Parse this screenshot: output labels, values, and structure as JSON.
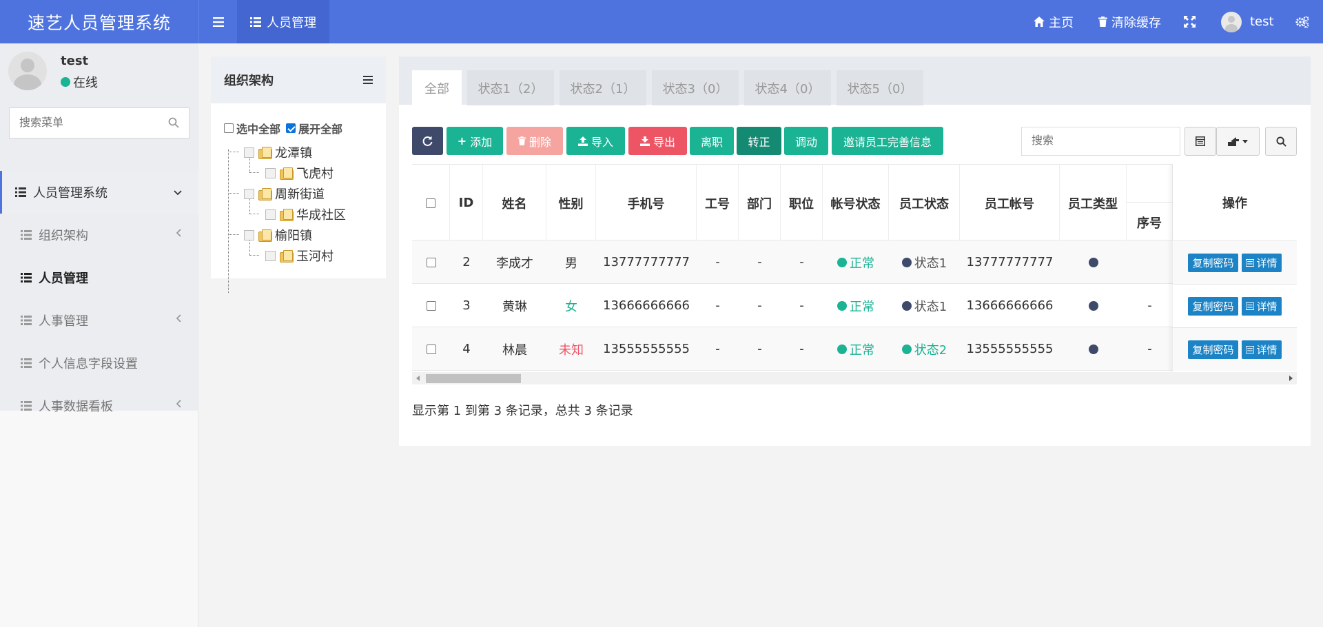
{
  "app": {
    "title": "速艺人员管理系统"
  },
  "topbar": {
    "nav_tab": "人员管理",
    "home": "主页",
    "clear_cache": "清除缓存",
    "username": "test",
    "brand_color": "#4e73df"
  },
  "sidebar": {
    "user": {
      "name": "test",
      "status": "在线"
    },
    "search_placeholder": "搜索菜单",
    "items": [
      {
        "label": "人员管理系统"
      },
      {
        "label": "组织架构"
      },
      {
        "label": "人员管理"
      },
      {
        "label": "人事管理"
      },
      {
        "label": "个人信息字段设置"
      },
      {
        "label": "人事数据看板"
      }
    ]
  },
  "org": {
    "title": "组织架构",
    "select_all": "选中全部",
    "expand_all": "展开全部",
    "expand_all_checked": true,
    "nodes": [
      {
        "label": "龙潭镇"
      },
      {
        "label": "飞虎村"
      },
      {
        "label": "周新街道"
      },
      {
        "label": "华成社区"
      },
      {
        "label": "榆阳镇"
      },
      {
        "label": "玉河村"
      }
    ]
  },
  "tabs": [
    "全部",
    "状态1（2）",
    "状态2（1）",
    "状态3（0）",
    "状态4（0）",
    "状态5（0）"
  ],
  "toolbar": {
    "add": "添加",
    "delete": "删除",
    "import": "导入",
    "export": "导出",
    "resign": "离职",
    "regularize": "转正",
    "transfer": "调动",
    "invite": "邀请员工完善信息",
    "search_placeholder": "搜索"
  },
  "table": {
    "headers": [
      "ID",
      "姓名",
      "性别",
      "手机号",
      "工号",
      "部门",
      "职位",
      "帐号状态",
      "员工状态",
      "员工帐号",
      "员工类型",
      "序号",
      "操作"
    ],
    "rows": [
      {
        "id": "2",
        "name": "李成才",
        "gender": "男",
        "phone": "13777777777",
        "job_no": "-",
        "dept": "-",
        "position": "-",
        "account_status": "正常",
        "emp_status": "状态1",
        "emp_account": "13777777777",
        "seq": ""
      },
      {
        "id": "3",
        "name": "黄琳",
        "gender": "女",
        "phone": "13666666666",
        "job_no": "-",
        "dept": "-",
        "position": "-",
        "account_status": "正常",
        "emp_status": "状态1",
        "emp_account": "13666666666",
        "seq": "-"
      },
      {
        "id": "4",
        "name": "林晨",
        "gender": "未知",
        "phone": "13555555555",
        "job_no": "-",
        "dept": "-",
        "position": "-",
        "account_status": "正常",
        "emp_status": "状态2",
        "emp_account": "13555555555",
        "seq": "-"
      }
    ],
    "copy_pwd": "复制密码",
    "detail": "详情"
  },
  "pager": {
    "text": "显示第 1 到第 3 条记录，总共 3 条记录"
  }
}
